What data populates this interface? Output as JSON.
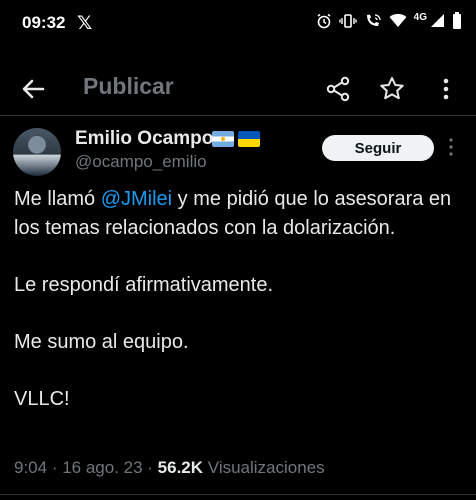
{
  "status_bar": {
    "time": "09:32",
    "app_logo": "𝕏",
    "network": "4G",
    "icons": [
      "alarm-icon",
      "vibrate-icon",
      "wifi-call-icon",
      "wifi-icon",
      "signal-icon",
      "battery-icon"
    ]
  },
  "app_bar": {
    "title": "Publicar",
    "icons": [
      "back-arrow-icon",
      "share-icon",
      "star-icon",
      "more-vert-icon"
    ]
  },
  "tweet": {
    "author_name": "Emilio Ocampo",
    "author_flags": [
      "argentina-flag",
      "ukraine-flag"
    ],
    "handle": "@ocampo_emilio",
    "follow_label": "Seguir",
    "text_line1_pre": "Me llamó ",
    "mention": "@JMilei",
    "text_line1_post": " y me pidió que lo asesorara en los temas relacionados con la dolarización.",
    "text_line2": "Le respondí afirmativamente.",
    "text_line3": "Me sumo al equipo.",
    "text_line4": "VLLC!",
    "time": "9:04",
    "date": "16 ago. 23",
    "views_count": "56.2K",
    "views_label": "Visualizaciones"
  },
  "colors": {
    "background": "#000000",
    "text": "#e7e9ea",
    "muted": "#71767b",
    "link": "#1d9bf0",
    "follow_bg": "#eff3f4"
  }
}
